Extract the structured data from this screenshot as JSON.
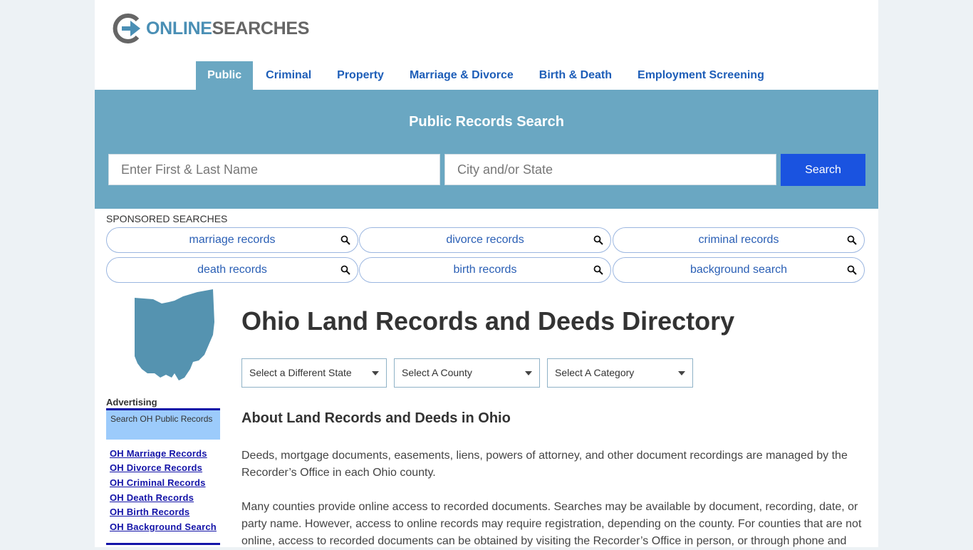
{
  "logo": {
    "part1": "ONLINE",
    "part2": "SEARCHES"
  },
  "nav": [
    {
      "label": "Public",
      "active": true
    },
    {
      "label": "Criminal"
    },
    {
      "label": "Property"
    },
    {
      "label": "Marriage & Divorce"
    },
    {
      "label": "Birth & Death"
    },
    {
      "label": "Employment Screening"
    }
  ],
  "search": {
    "title": "Public Records Search",
    "name_placeholder": "Enter First & Last Name",
    "location_placeholder": "City and/or State",
    "button": "Search"
  },
  "sponsored": {
    "label": "SPONSORED SEARCHES",
    "items": [
      "marriage records",
      "divorce records",
      "criminal records",
      "death records",
      "birth records",
      "background search"
    ]
  },
  "sidebar": {
    "advertising_label": "Advertising",
    "box_text": "Search OH Public Records",
    "links": [
      "OH Marriage Records",
      "OH Divorce Records",
      "OH Criminal Records",
      "OH Death Records",
      "OH Birth Records",
      "OH Background Search"
    ]
  },
  "main": {
    "title": "Ohio Land Records and Deeds Directory",
    "selects": [
      "Select a Different State",
      "Select A County",
      "Select A Category"
    ],
    "subtitle": "About Land Records and Deeds in Ohio",
    "paragraphs": [
      "Deeds, mortgage documents, easements, liens, powers of attorney, and other document recordings are managed by the Recorder’s Office in each Ohio county.",
      "Many counties provide online access to recorded documents. Searches may be available by document, recording, date, or party name. However, access to online records may require registration, depending on the county. For counties that are not online, access to recorded documents can be obtained by visiting the Recorder’s Office in person, or through phone and"
    ]
  },
  "colors": {
    "accent": "#6aa7c2",
    "button": "#1a53e0",
    "link": "#1e5eb8",
    "sidebar_link": "#1414a8"
  }
}
